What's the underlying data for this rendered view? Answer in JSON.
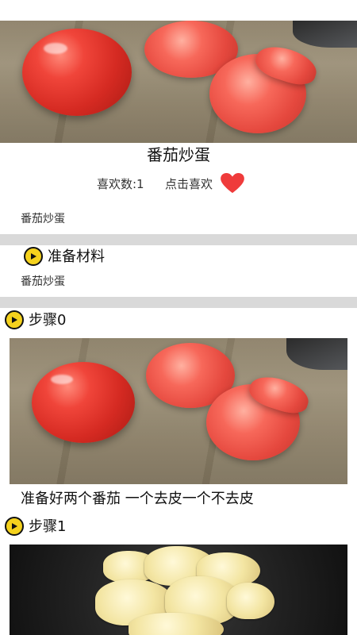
{
  "recipe": {
    "title": "番茄炒蛋",
    "likes_label": "喜欢数:1",
    "like_action": "点击喜欢",
    "description": "番茄炒蛋"
  },
  "ingredients": {
    "heading": "准备材料",
    "text": "番茄炒蛋"
  },
  "steps": [
    {
      "label": "步骤0",
      "caption": "准备好两个番茄 一个去皮一个不去皮"
    },
    {
      "label": "步骤1"
    }
  ],
  "colors": {
    "heart": "#ef3b3b",
    "play_icon": "#f5d21d",
    "separator": "#d9d9d9"
  },
  "icons": [
    "heart-icon",
    "play-icon"
  ]
}
